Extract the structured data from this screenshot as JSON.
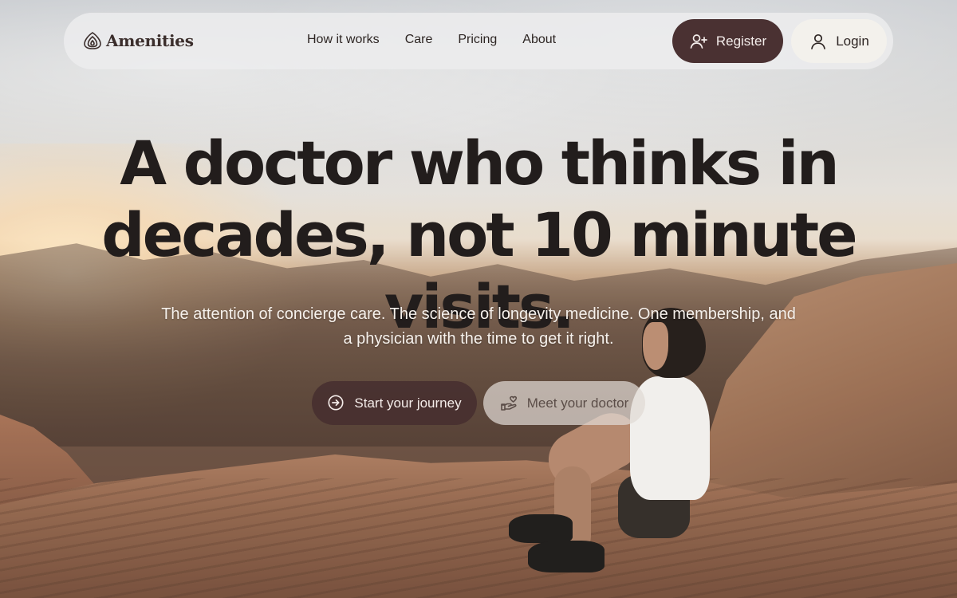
{
  "brand": {
    "name": "Amenities",
    "logo_icon": "concentric-shell-logo-icon"
  },
  "nav": {
    "links": [
      "How it works",
      "Care",
      "Pricing",
      "About"
    ],
    "register_label": "Register",
    "register_icon": "user-plus-icon",
    "login_label": "Login",
    "login_icon": "user-icon"
  },
  "hero": {
    "title_line1": "A doctor who thinks in",
    "title_line2": "decades, not 10 minute visits.",
    "subtitle": "The attention of concierge care. The science of longevity medicine. One membership, and a physician with the time to get it right."
  },
  "cta": {
    "start_label": "Start your journey",
    "start_icon": "arrow-circle-right-icon",
    "meet_label": "Meet your doctor",
    "meet_icon": "hand-heart-icon"
  },
  "colors": {
    "primary": "#4a3132",
    "nav_bg": "#ececee",
    "login_bg": "#f3f1ec",
    "heading": "#221d1c"
  }
}
